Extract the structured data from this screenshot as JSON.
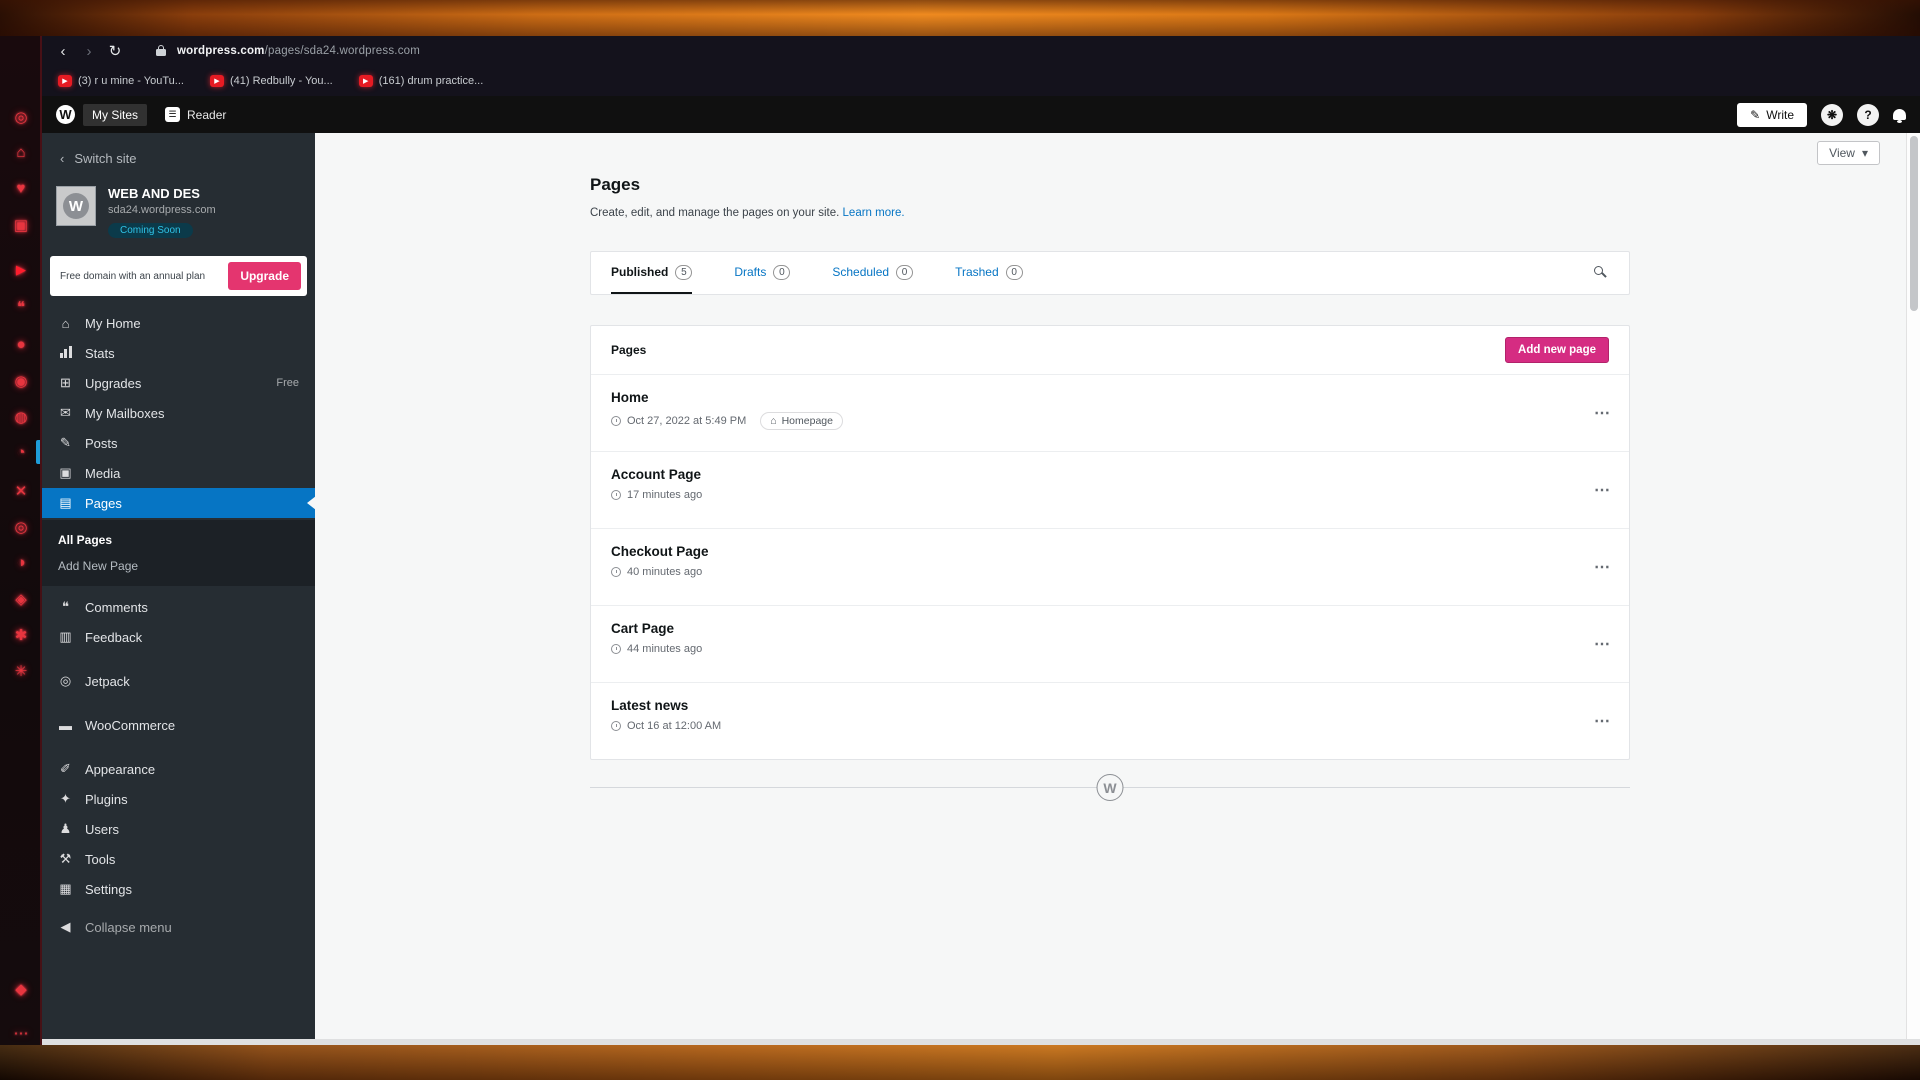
{
  "browser": {
    "url_host": "wordpress.com",
    "url_path": "/pages/sda24.wordpress.com",
    "bookmarks": [
      {
        "label": "(3) r u mine - YouTu..."
      },
      {
        "label": "(41) Redbully - You..."
      },
      {
        "label": "(161) drum practice..."
      }
    ]
  },
  "masthead": {
    "my_sites": "My Sites",
    "reader": "Reader",
    "write": "Write"
  },
  "sidebar": {
    "switch_site": "Switch site",
    "site": {
      "name": "WEB AND DES",
      "domain": "sda24.wordpress.com",
      "badge": "Coming Soon"
    },
    "upgrade": {
      "text": "Free domain with an annual plan",
      "button": "Upgrade"
    },
    "menu": [
      {
        "label": "My Home"
      },
      {
        "label": "Stats"
      },
      {
        "label": "Upgrades",
        "meta": "Free"
      },
      {
        "label": "My Mailboxes"
      },
      {
        "label": "Posts"
      },
      {
        "label": "Media"
      },
      {
        "label": "Pages"
      },
      {
        "label": "Comments"
      },
      {
        "label": "Feedback"
      },
      {
        "label": "Jetpack"
      },
      {
        "label": "WooCommerce"
      },
      {
        "label": "Appearance"
      },
      {
        "label": "Plugins"
      },
      {
        "label": "Users"
      },
      {
        "label": "Tools"
      },
      {
        "label": "Settings"
      },
      {
        "label": "Collapse menu"
      }
    ],
    "submenu": [
      {
        "label": "All Pages"
      },
      {
        "label": "Add New Page"
      }
    ]
  },
  "main": {
    "view_button": "View",
    "title": "Pages",
    "description": "Create, edit, and manage the pages on your site.",
    "learn_more": "Learn more.",
    "tabs": [
      {
        "label": "Published",
        "count": "5"
      },
      {
        "label": "Drafts",
        "count": "0"
      },
      {
        "label": "Scheduled",
        "count": "0"
      },
      {
        "label": "Trashed",
        "count": "0"
      }
    ],
    "list_header": {
      "title": "Pages",
      "add_button": "Add new page"
    },
    "rows": [
      {
        "title": "Home",
        "date": "Oct 27, 2022 at 5:49 PM",
        "badge": "Homepage"
      },
      {
        "title": "Account Page",
        "date": "17 minutes ago"
      },
      {
        "title": "Checkout Page",
        "date": "40 minutes ago"
      },
      {
        "title": "Cart Page",
        "date": "44 minutes ago"
      },
      {
        "title": "Latest news",
        "date": "Oct 16 at 12:00 AM"
      }
    ]
  },
  "icons": {
    "back": "‹",
    "forward": "›",
    "reload": "↻",
    "bookmark_play": "▶",
    "wp": "W",
    "reader": "☰",
    "pencil": "✎",
    "help": "?",
    "avatar": "❋",
    "chevron_left": "‹",
    "caret_down": "▾",
    "ellipsis": "⋯",
    "home": "⌂",
    "cart": "⊞",
    "mail": "✉",
    "posts": "✎",
    "media": "▣",
    "pages": "▤",
    "comments": "❝",
    "feedback": "▥",
    "jetpack": "◎",
    "woo": "▬",
    "appearance": "✐",
    "plugins": "✦",
    "users": "♟",
    "tools": "⚒",
    "settings": "▦",
    "collapse": "◀",
    "house": "⌂",
    "w_logo": "W"
  },
  "dock": [
    {
      "name": "app-icon-swirl",
      "glyph": "◎"
    },
    {
      "name": "app-icon-home",
      "glyph": "⌂"
    },
    {
      "name": "app-icon-heart",
      "glyph": "♥"
    },
    {
      "name": "app-icon-box",
      "glyph": "▣"
    },
    {
      "name": "app-icon-youtube",
      "glyph": "▶"
    },
    {
      "name": "app-icon-chat",
      "glyph": "❝"
    },
    {
      "name": "app-icon-record",
      "glyph": "●"
    },
    {
      "name": "app-icon-camera",
      "glyph": "◉"
    },
    {
      "name": "app-icon-disc",
      "glyph": "◍"
    },
    {
      "name": "app-icon-eye",
      "glyph": "◔"
    },
    {
      "name": "app-icon-x",
      "glyph": "✕"
    },
    {
      "name": "app-icon-ring",
      "glyph": "◎"
    },
    {
      "name": "app-icon-clock",
      "glyph": "◑"
    },
    {
      "name": "app-icon-target",
      "glyph": "◈"
    },
    {
      "name": "app-icon-star",
      "glyph": "✱"
    },
    {
      "name": "app-icon-gear",
      "glyph": "✳"
    },
    {
      "name": "app-icon-badge",
      "glyph": "◆"
    },
    {
      "name": "app-icon-more",
      "glyph": "⋯"
    }
  ],
  "colors": {
    "accent_pink": "#d52c82",
    "wp_blue": "#0675c4",
    "sidebar_active": "#0675c4",
    "frame_orange": "#ef8a1f"
  }
}
